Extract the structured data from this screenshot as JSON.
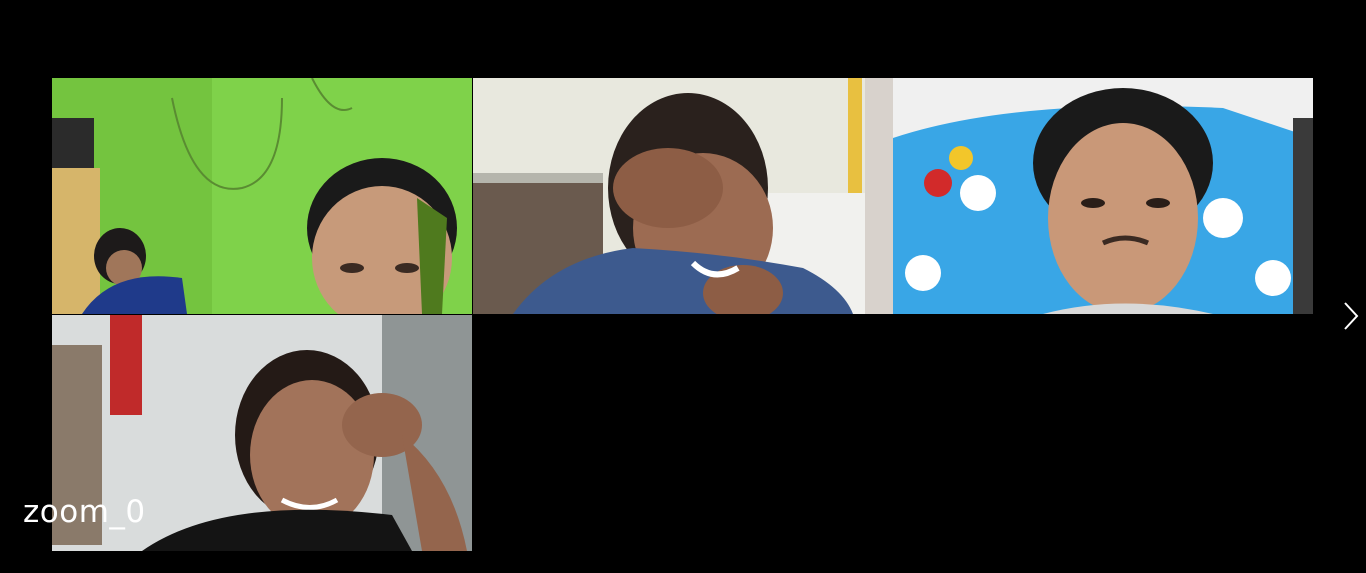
{
  "meeting": {
    "watermark_label": "zoom_0",
    "next_page_icon": "chevron-right-icon"
  },
  "participants": [
    {
      "tile": "participant-video-1"
    },
    {
      "tile": "participant-video-2"
    },
    {
      "tile": "participant-video-3"
    },
    {
      "tile": "participant-video-4"
    }
  ],
  "colors": {
    "background": "#000000",
    "tile1_wall": "#7fd24a",
    "tile2_wall": "#e8e8de",
    "tile3_pillow": "#39a6e6",
    "tile4_wall": "#d9dcdc"
  }
}
